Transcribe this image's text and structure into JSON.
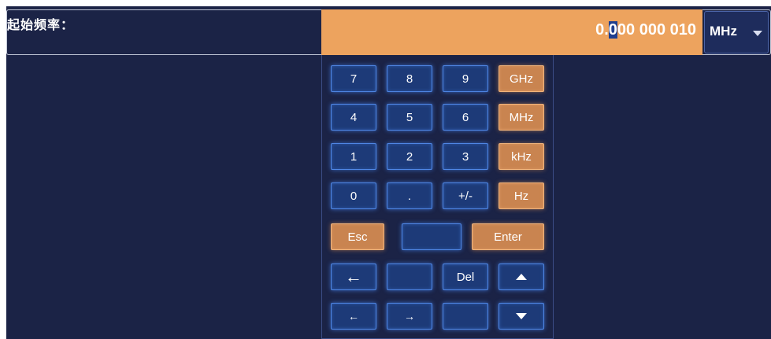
{
  "field": {
    "label": "起始频率：",
    "value_before_cursor": "0.",
    "value_cursor": "0",
    "value_after_cursor": "00 000 010",
    "unit": "MHz"
  },
  "keypad": {
    "k7": "7",
    "k8": "8",
    "k9": "9",
    "ghz": "GHz",
    "k4": "4",
    "k5": "5",
    "k6": "6",
    "mhz": "MHz",
    "k1": "1",
    "k2": "2",
    "k3": "3",
    "khz": "kHz",
    "k0": "0",
    "dot": ".",
    "sign": "+/-",
    "hz": "Hz",
    "esc": "Esc",
    "enter": "Enter",
    "backspace": "←",
    "del": "Del",
    "left": "←",
    "right": "→"
  },
  "colors": {
    "background": "#1b2346",
    "value_highlight": "#eda35e",
    "key_blue": "#1d3a78",
    "key_orange": "#c98450",
    "cursor": "#1f3f8f"
  },
  "icons": {
    "dropdown": "chevron-down-icon",
    "backspace": "backspace-arrow-icon",
    "up": "triangle-up-icon",
    "down": "triangle-down-icon",
    "left": "arrow-left-icon",
    "right": "arrow-right-icon"
  }
}
